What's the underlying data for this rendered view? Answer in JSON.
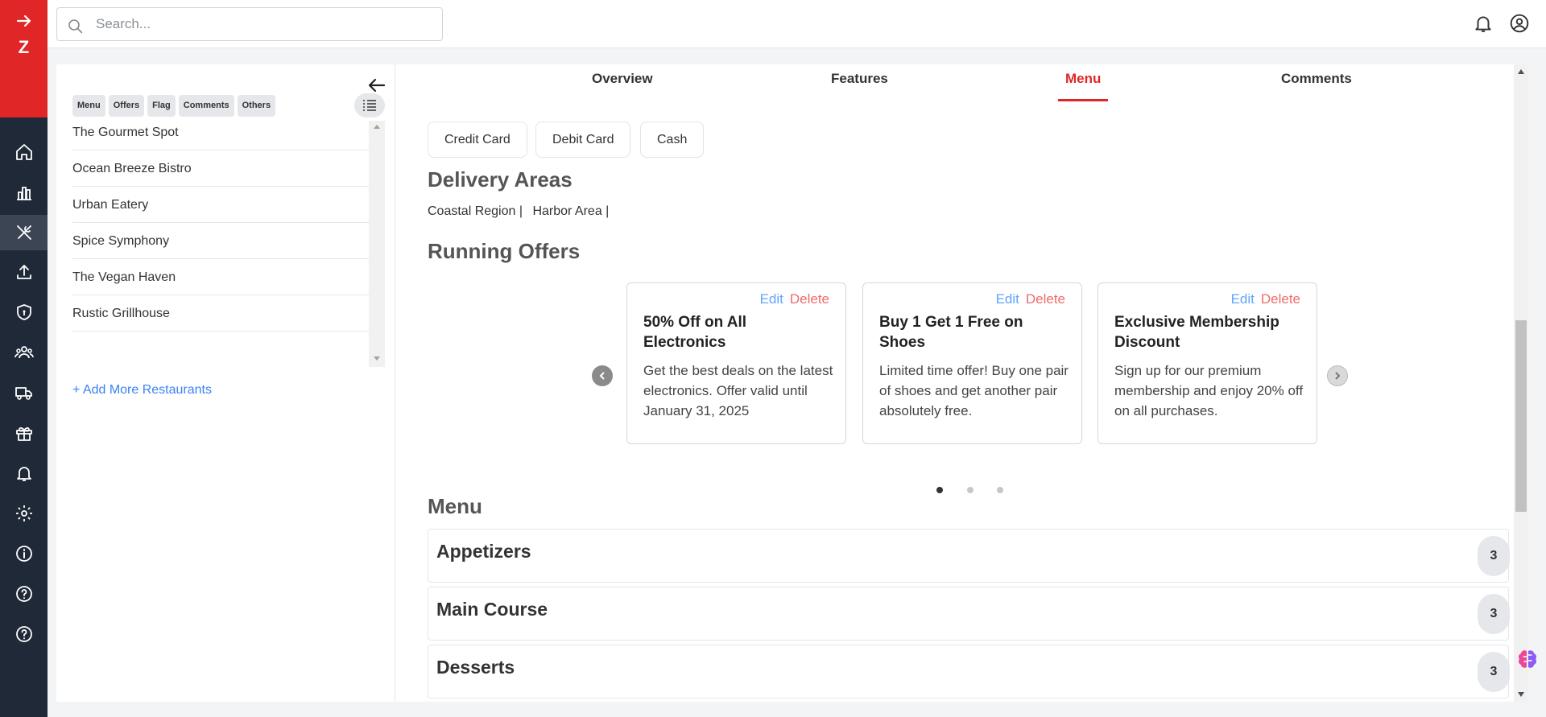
{
  "colors": {
    "brand": "#e02626",
    "rail": "#1f2937",
    "link": "#3b82f6",
    "edit": "#60a5fa",
    "delete": "#ef6b6b"
  },
  "brand": {
    "letter": "Z",
    "icon": "arrow-right-icon"
  },
  "rail": {
    "items": [
      {
        "icon": "home-icon"
      },
      {
        "icon": "bar-chart-icon"
      },
      {
        "icon": "restaurant-icon",
        "active": true
      },
      {
        "icon": "upload-icon"
      },
      {
        "icon": "shield-icon"
      },
      {
        "icon": "users-icon"
      },
      {
        "icon": "delivery-truck-icon"
      },
      {
        "icon": "gift-icon"
      },
      {
        "icon": "bell-icon"
      },
      {
        "icon": "settings-icon"
      },
      {
        "icon": "info-icon"
      },
      {
        "icon": "help-icon"
      },
      {
        "icon": "help-icon"
      }
    ]
  },
  "search": {
    "placeholder": "Search..."
  },
  "header": {
    "icons": [
      "notification-bell-icon",
      "user-account-icon"
    ]
  },
  "restaurants": {
    "filters": [
      "Menu",
      "Offers",
      "Flag",
      "Comments",
      "Others"
    ],
    "items": [
      "The Gourmet Spot",
      "Ocean Breeze Bistro",
      "Urban Eatery",
      "Spice Symphony",
      "The Vegan Haven",
      "Rustic Grillhouse"
    ],
    "add_more": "+ Add More Restaurants"
  },
  "tabs": {
    "overview": "Overview",
    "features": "Features",
    "menu": "Menu",
    "comments": "Comments",
    "active": "Menu"
  },
  "payment_methods": [
    "Credit Card",
    "Debit Card",
    "Cash"
  ],
  "delivery": {
    "title": "Delivery Areas",
    "areas": [
      "Coastal Region |",
      "Harbor Area |"
    ]
  },
  "offers": {
    "title": "Running Offers",
    "edit_label": "Edit",
    "delete_label": "Delete",
    "items": [
      {
        "title": "50% Off on All Electronics",
        "description": "Get the best deals on the latest electronics. Offer valid until January 31, 2025"
      },
      {
        "title": "Buy 1 Get 1 Free on Shoes",
        "description": "Limited time offer! Buy one pair of shoes and get another pair absolutely free."
      },
      {
        "title": "Exclusive Membership Discount",
        "description": "Sign up for our premium membership and enjoy 20% off on all purchases."
      }
    ],
    "current_page": 1,
    "page_count": 3
  },
  "menu": {
    "title": "Menu",
    "categories": [
      {
        "name": "Appetizers",
        "count": "3"
      },
      {
        "name": "Main Course",
        "count": "3"
      },
      {
        "name": "Desserts",
        "count": "3"
      }
    ]
  }
}
